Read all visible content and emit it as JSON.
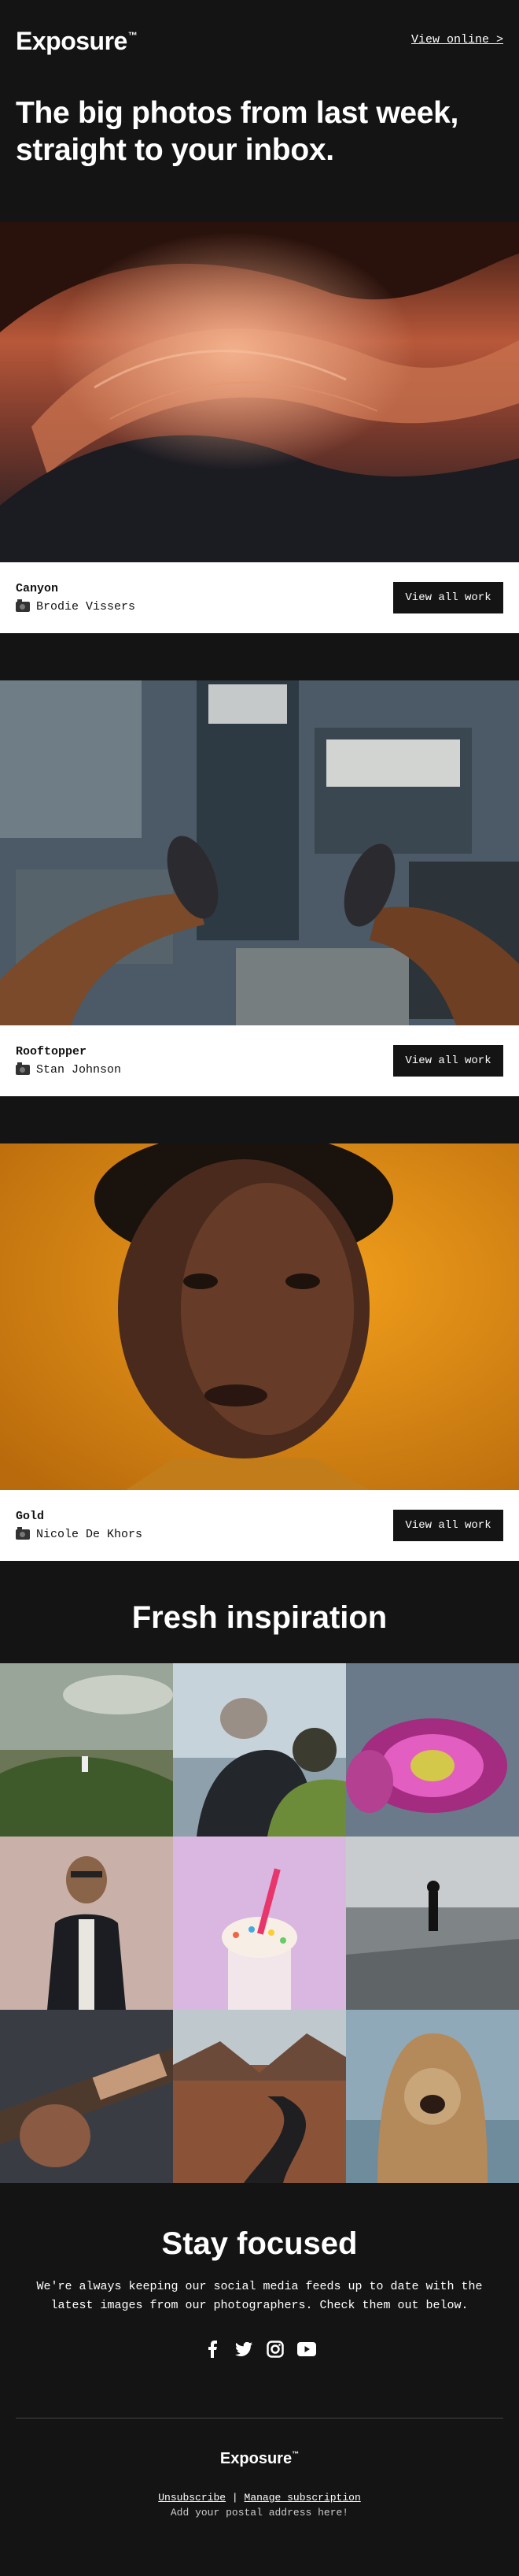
{
  "header": {
    "logo": "Exposure",
    "logo_mark": "™",
    "view_online": "View online >"
  },
  "hero": {
    "title": "The big photos from last week, straight to your inbox."
  },
  "cards": [
    {
      "title": "Canyon",
      "author": "Brodie Vissers",
      "button": "View all work"
    },
    {
      "title": "Rooftopper",
      "author": "Stan Johnson",
      "button": "View all work"
    },
    {
      "title": "Gold",
      "author": "Nicole De Khors",
      "button": "View all work"
    }
  ],
  "fresh": {
    "title": "Fresh inspiration"
  },
  "focus": {
    "title": "Stay focused",
    "text": "We're always keeping our social media feeds up to date with the latest images from our photographers. Check them out below."
  },
  "footer": {
    "logo": "Exposure",
    "logo_mark": "™",
    "unsubscribe": "Unsubscribe",
    "separator": "|",
    "manage": "Manage subscription",
    "address": "Add your postal address here!"
  }
}
